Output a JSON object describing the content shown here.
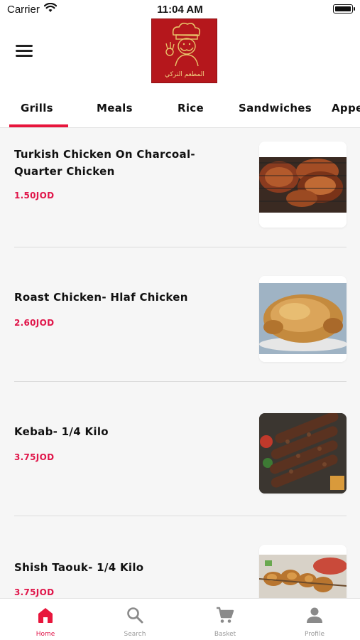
{
  "status_bar": {
    "carrier": "Carrier",
    "time": "11:04 AM"
  },
  "header": {
    "logo_text": "المطعم التركي"
  },
  "tabs": [
    {
      "label": "Grills",
      "active": true
    },
    {
      "label": "Meals",
      "active": false
    },
    {
      "label": "Rice",
      "active": false
    },
    {
      "label": "Sandwiches",
      "active": false
    },
    {
      "label": "Appe",
      "active": false
    }
  ],
  "items": [
    {
      "name": "Turkish Chicken On Charcoal- Quarter Chicken",
      "price": "1.50JOD",
      "image": "grilled-chicken"
    },
    {
      "name": "Roast Chicken- Hlaf Chicken",
      "price": "2.60JOD",
      "image": "roast-chicken"
    },
    {
      "name": "Kebab- 1/4 Kilo",
      "price": "3.75JOD",
      "image": "kebab"
    },
    {
      "name": "Shish Taouk- 1/4 Kilo",
      "price": "3.75JOD",
      "image": "shish-taouk"
    }
  ],
  "bottom_nav": [
    {
      "label": "Home",
      "icon": "home-icon",
      "active": true
    },
    {
      "label": "Search",
      "icon": "search-icon",
      "active": false
    },
    {
      "label": "Basket",
      "icon": "cart-icon",
      "active": false
    },
    {
      "label": "Profile",
      "icon": "person-icon",
      "active": false
    }
  ],
  "colors": {
    "accent": "#e8163c",
    "price": "#e0164a",
    "logo_bg": "#b5171c"
  }
}
